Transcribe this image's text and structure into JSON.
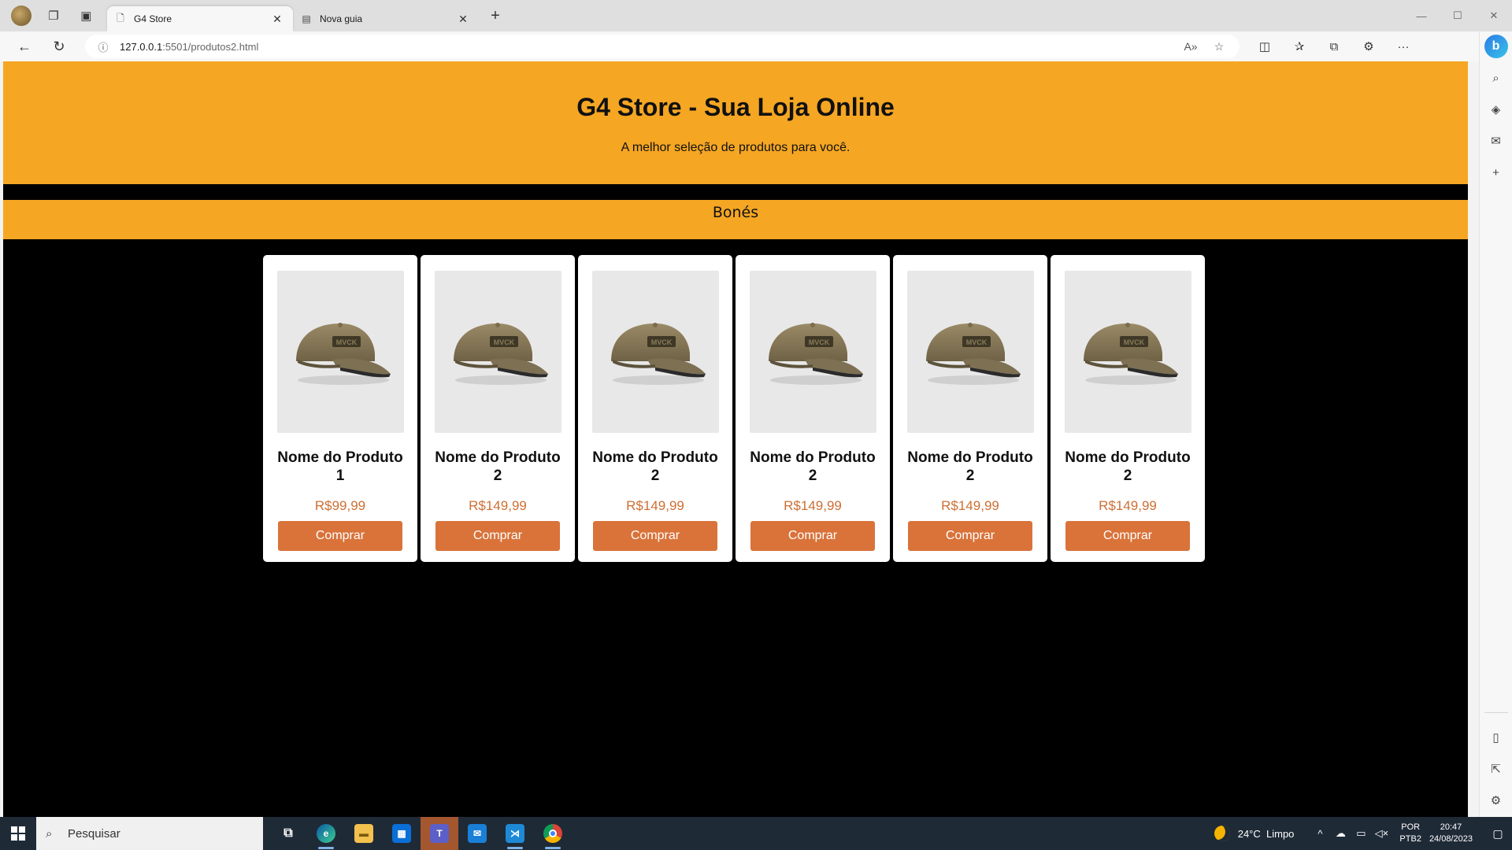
{
  "browser": {
    "tabs": [
      {
        "title": "G4 Store",
        "active": true,
        "icon": "page-icon"
      },
      {
        "title": "Nova guia",
        "active": false,
        "icon": "newtab-page-icon"
      }
    ],
    "url_host": "127.0.0.1",
    "url_path": ":5501/produtos2.html"
  },
  "site": {
    "title": "G4 Store - Sua Loja Online",
    "subtitle": "A melhor seleção de produtos para você.",
    "category": "Bonés",
    "accent_color": "#f5a623",
    "button_color": "#d9733a"
  },
  "products": [
    {
      "name": "Nome do Produto 1",
      "price": "R$99,99",
      "button": "Comprar",
      "image": "cap-image"
    },
    {
      "name": "Nome do Produto 2",
      "price": "R$149,99",
      "button": "Comprar",
      "image": "cap-image"
    },
    {
      "name": "Nome do Produto 2",
      "price": "R$149,99",
      "button": "Comprar",
      "image": "cap-image"
    },
    {
      "name": "Nome do Produto 2",
      "price": "R$149,99",
      "button": "Comprar",
      "image": "cap-image"
    },
    {
      "name": "Nome do Produto 2",
      "price": "R$149,99",
      "button": "Comprar",
      "image": "cap-image"
    },
    {
      "name": "Nome do Produto 2",
      "price": "R$149,99",
      "button": "Comprar",
      "image": "cap-image"
    }
  ],
  "taskbar": {
    "search_placeholder": "Pesquisar",
    "temperature": "24°C",
    "weather": "Limpo",
    "lang_top": "POR",
    "lang_bottom": "PTB2",
    "time": "20:47",
    "date": "24/08/2023"
  }
}
